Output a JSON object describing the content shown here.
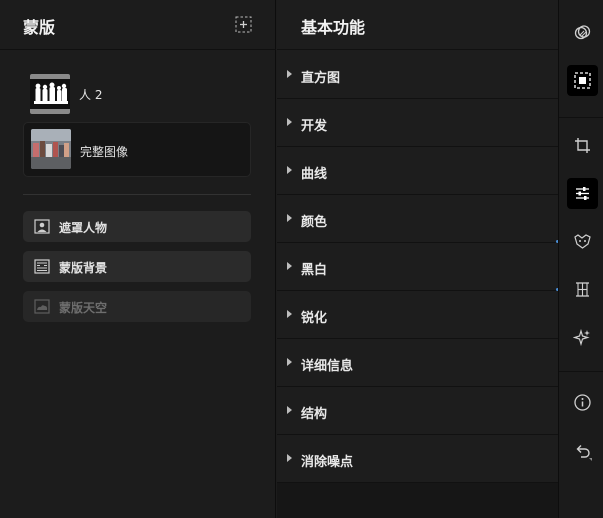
{
  "masks_panel": {
    "title": "蒙版",
    "add_icon": "add-mask-icon",
    "masks": [
      {
        "label": "人 2",
        "thumb": "people-silhouette-thumbnail"
      },
      {
        "label": "完整图像",
        "thumb": "full-image-thumbnail"
      }
    ],
    "actions": [
      {
        "label": "遮罩人物",
        "icon": "person-mask-icon",
        "enabled": true
      },
      {
        "label": "蒙版背景",
        "icon": "background-mask-icon",
        "enabled": true
      },
      {
        "label": "蒙版天空",
        "icon": "sky-mask-icon",
        "enabled": false
      }
    ]
  },
  "basic_panel": {
    "title": "基本功能",
    "sections": [
      "直方图",
      "开发",
      "曲线",
      "颜色",
      "黑白",
      "锐化",
      "详细信息",
      "结构",
      "消除噪点"
    ]
  },
  "toolbar": {
    "tools": [
      {
        "name": "mask-overlay-icon",
        "active": false
      },
      {
        "name": "mask-select-icon",
        "active": true
      },
      {
        "name": "crop-icon",
        "active": false
      },
      {
        "name": "adjust-sliders-icon",
        "active": true
      },
      {
        "name": "heal-icon",
        "active": false
      },
      {
        "name": "transform-icon",
        "active": false
      },
      {
        "name": "sparkle-icon",
        "active": false
      },
      {
        "name": "info-icon",
        "active": false
      },
      {
        "name": "undo-icon",
        "active": false
      }
    ]
  },
  "colors": {
    "background": "#1c1c1c",
    "pill": "#2b2b2b",
    "active_tool": "#000000",
    "accent_dot": "#4a8ed6"
  }
}
